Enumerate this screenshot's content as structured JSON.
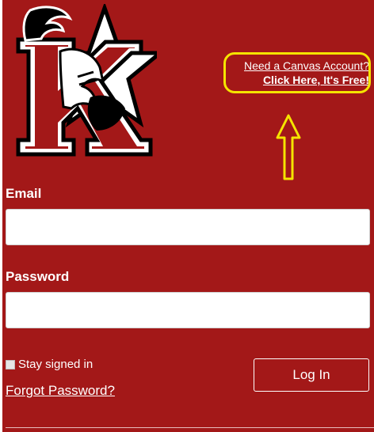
{
  "signup": {
    "line1": "Need a Canvas Account?",
    "line2": "Click Here, It's Free!"
  },
  "annotation": {
    "highlight_color": "#f5e400"
  },
  "logo": {
    "icon": "k-knight-star-logo"
  },
  "form": {
    "email_label": "Email",
    "email_value": "",
    "password_label": "Password",
    "password_value": "",
    "stay_signed_in_label": "Stay signed in",
    "stay_signed_in_checked": false,
    "forgot_password": "Forgot Password?",
    "login_button": "Log In"
  },
  "colors": {
    "background": "#a31818",
    "text": "#ffffff"
  }
}
